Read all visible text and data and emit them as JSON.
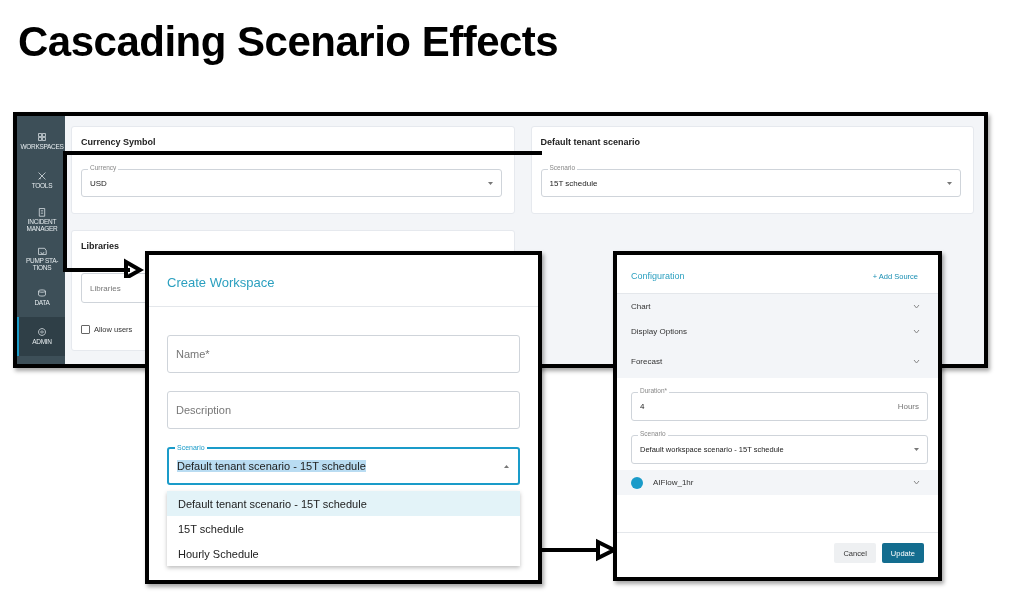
{
  "title": "Cascading Scenario Effects",
  "settings": {
    "sidebar": [
      {
        "label": "WORKSPACES",
        "selected": false
      },
      {
        "label": "TOOLS",
        "selected": false
      },
      {
        "label": "INCIDENT MANAGER",
        "selected": false
      },
      {
        "label": "PUMP STA-TIONS",
        "selected": false
      },
      {
        "label": "DATA",
        "selected": false
      },
      {
        "label": "ADMIN",
        "selected": true
      }
    ],
    "currency": {
      "title": "Currency Symbol",
      "label": "Currency",
      "value": "USD"
    },
    "tenant": {
      "title": "Default tenant scenario",
      "label": "Scenario",
      "value": "15T schedule"
    },
    "libraries": {
      "title": "Libraries",
      "placeholder": "Libraries",
      "checkbox": {
        "label": "Allow users",
        "checked": false
      }
    }
  },
  "create_workspace": {
    "title": "Create Workspace",
    "name_placeholder": "Name*",
    "description_placeholder": "Description",
    "scenario": {
      "label": "Scenario",
      "value": "Default tenant scenario - 15T schedule",
      "focused": true
    },
    "options": [
      {
        "label": "Default tenant scenario - 15T schedule",
        "selected": true
      },
      {
        "label": "15T schedule",
        "selected": false
      },
      {
        "label": "Hourly Schedule",
        "selected": false
      }
    ]
  },
  "configuration": {
    "title": "Configuration",
    "add_source": "+ Add Source",
    "sections": [
      "Chart",
      "Display Options",
      "Forecast"
    ],
    "duration": {
      "label": "Duration*",
      "value": "4",
      "unit": "Hours"
    },
    "scenario": {
      "label": "Scenario",
      "value": "Default workspace scenario - 15T schedule"
    },
    "sources": [
      {
        "name": "AIFlow_1hr",
        "color": "#1a9bc9"
      }
    ],
    "buttons": {
      "cancel": "Cancel",
      "update": "Update"
    }
  }
}
